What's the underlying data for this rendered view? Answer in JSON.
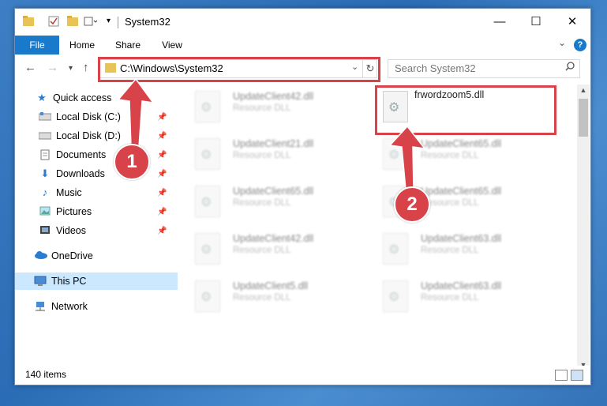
{
  "window": {
    "title": "System32",
    "buttons": {
      "minimize": "—",
      "maximize": "☐",
      "close": "✕"
    }
  },
  "ribbon": {
    "tabs": [
      "File",
      "Home",
      "Share",
      "View"
    ],
    "expand": "⌄",
    "help": "?"
  },
  "nav": {
    "address": "C:\\Windows\\System32",
    "search_placeholder": "Search System32"
  },
  "sidebar": {
    "items": [
      {
        "label": "Quick access",
        "icon": "star-icon",
        "pinned": false
      },
      {
        "label": "Local Disk (C:)",
        "icon": "drive-icon",
        "pinned": true
      },
      {
        "label": "Local Disk (D:)",
        "icon": "drive-icon",
        "pinned": true
      },
      {
        "label": "Documents",
        "icon": "documents-icon",
        "pinned": true
      },
      {
        "label": "Downloads",
        "icon": "download-icon",
        "pinned": true
      },
      {
        "label": "Music",
        "icon": "music-icon",
        "pinned": true
      },
      {
        "label": "Pictures",
        "icon": "pictures-icon",
        "pinned": true
      },
      {
        "label": "Videos",
        "icon": "videos-icon",
        "pinned": true
      },
      {
        "label": "OneDrive",
        "icon": "cloud-icon",
        "pinned": false
      },
      {
        "label": "This PC",
        "icon": "computer-icon",
        "pinned": false
      },
      {
        "label": "Network",
        "icon": "network-icon",
        "pinned": false
      }
    ]
  },
  "files": [
    {
      "name": "UpdateClient42.dll",
      "type": "Resource DLL"
    },
    {
      "name": "frwordzoom5.dll",
      "type": ""
    },
    {
      "name": "UpdateClient21.dll",
      "type": "Resource DLL"
    },
    {
      "name": "UpdateClient65.dll",
      "type": "Resource DLL"
    },
    {
      "name": "UpdateClient65.dll",
      "type": "Resource DLL"
    },
    {
      "name": "UpdateClient65.dll",
      "type": "Resource DLL"
    },
    {
      "name": "UpdateClient42.dll",
      "type": "Resource DLL"
    },
    {
      "name": "UpdateClient63.dll",
      "type": "Resource DLL"
    },
    {
      "name": "UpdateClient5.dll",
      "type": "Resource DLL"
    },
    {
      "name": "UpdateClient63.dll",
      "type": "Resource DLL"
    }
  ],
  "status": {
    "item_count": "140 items"
  },
  "annotations": {
    "step1": "1",
    "step2": "2",
    "color": "#d8434a"
  }
}
